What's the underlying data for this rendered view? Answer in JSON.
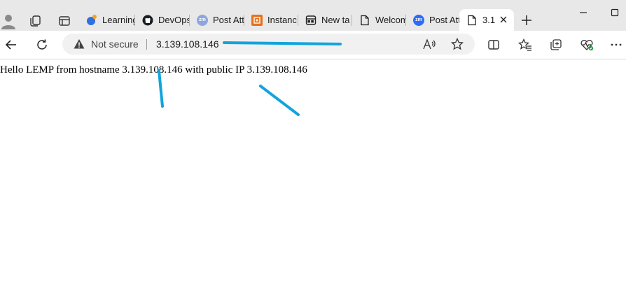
{
  "tabs": [
    {
      "label": "Learning",
      "icon": "learning-icon"
    },
    {
      "label": "DevOps",
      "icon": "github-icon"
    },
    {
      "label": "Post Att",
      "icon": "zm-icon"
    },
    {
      "label": "Instanc",
      "icon": "aws-instance-icon"
    },
    {
      "label": "New ta",
      "icon": "new-tab-page-icon"
    },
    {
      "label": "Welcom",
      "icon": "page-icon"
    },
    {
      "label": "Post Att",
      "icon": "zm-icon"
    },
    {
      "label": "3.1",
      "icon": "page-icon",
      "active": true
    }
  ],
  "zm_badge": "zm",
  "address_bar": {
    "security_label": "Not secure",
    "url": "3.139.108.146"
  },
  "page": {
    "text": "Hello LEMP from hostname 3.139.108.146 with public IP 3.139.108.146"
  },
  "colors": {
    "annotation": "#12a4dc",
    "tabstrip": "#e8e8e8",
    "zm_primary": "#2d6cf6",
    "zm_secondary": "#8ea6dd"
  }
}
